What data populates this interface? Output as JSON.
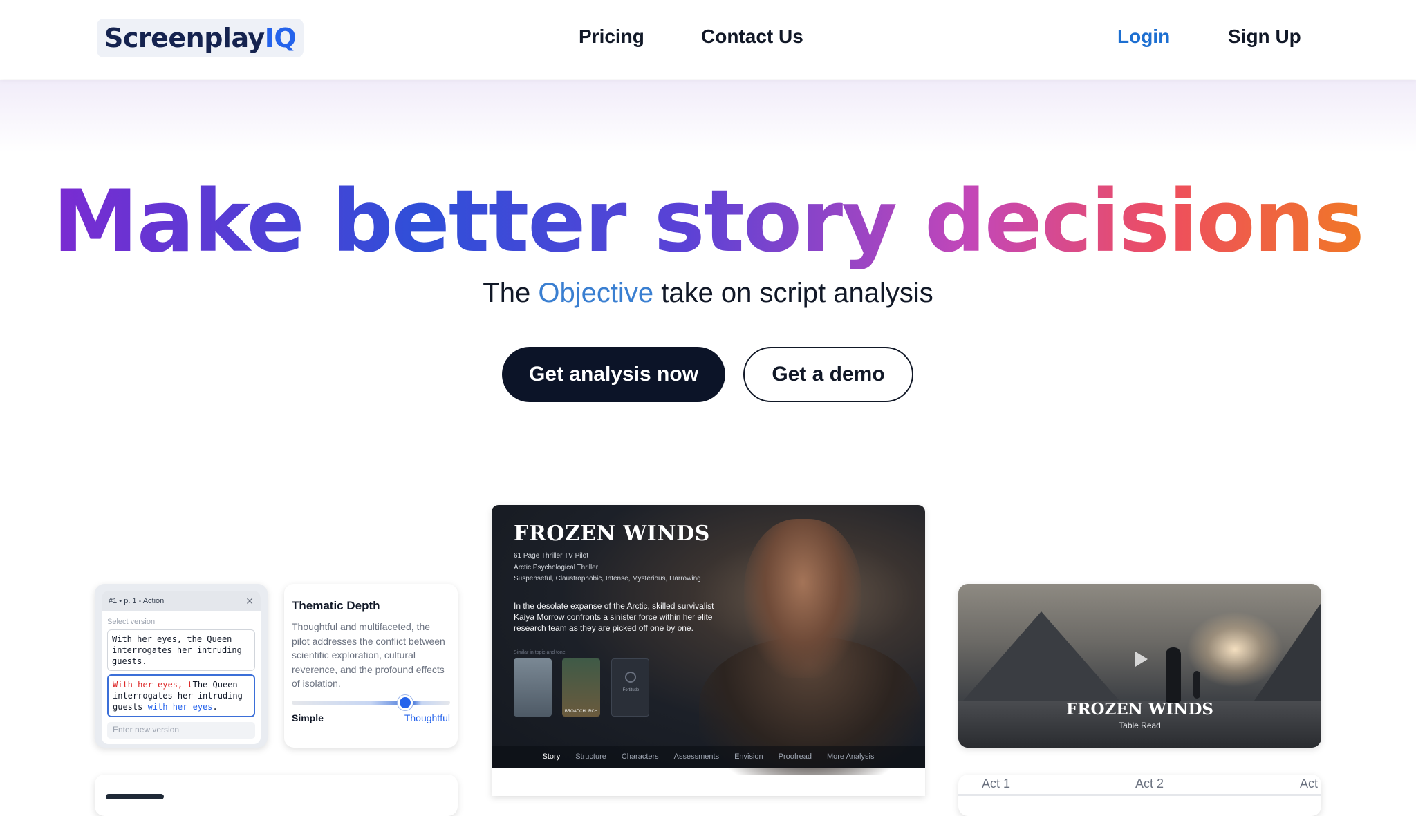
{
  "nav": {
    "logo_main": "Screenplay",
    "logo_accent": "IQ",
    "links": [
      "Pricing",
      "Contact Us"
    ],
    "login": "Login",
    "signup": "Sign Up"
  },
  "hero": {
    "headline": "Make better story decisions",
    "sub_before": "The",
    "sub_accent": "Objective",
    "sub_after": "take on script analysis",
    "primary_cta": "Get analysis now",
    "secondary_cta": "Get a demo"
  },
  "version_card": {
    "header": "#1 • p. 1 - Action",
    "select_label": "Select version",
    "option1": "With her eyes, the Queen interrogates her intruding guests.",
    "option2_removed": "With her eyes, t",
    "option2_text": "The Queen interrogates her intruding guests ",
    "option2_added": "with her eyes",
    "option2_end": ".",
    "input_placeholder": "Enter new version"
  },
  "thematic_card": {
    "title": "Thematic Depth",
    "description": "Thoughtful and multifaceted, the pilot addresses the conflict between scientific exploration, cultural reverence, and the profound effects of isolation.",
    "left_label": "Simple",
    "right_label": "Thoughtful",
    "slider_value": 0.73
  },
  "movie_card": {
    "title": "FROZEN WINDS",
    "meta": [
      "61 Page Thriller TV Pilot",
      "Arctic Psychological Thriller",
      "Suspenseful, Claustrophobic, Intense, Mysterious, Harrowing"
    ],
    "description": "In the desolate expanse of the Arctic, skilled survivalist Kaiya Morrow confronts a sinister force within her elite research team as they are picked off one by one.",
    "similar_label": "Similar in topic and tone",
    "poster2_label": "BROADCHURCH",
    "poster3_label": "Fortitude",
    "tabs": [
      "Story",
      "Structure",
      "Characters",
      "Assessments",
      "Envision",
      "Proofread",
      "More Analysis"
    ],
    "active_tab": "Story"
  },
  "video_card": {
    "title": "FROZEN WINDS",
    "subtitle": "Table Read"
  },
  "acts": [
    "Act 1",
    "Act 2",
    "Act"
  ]
}
